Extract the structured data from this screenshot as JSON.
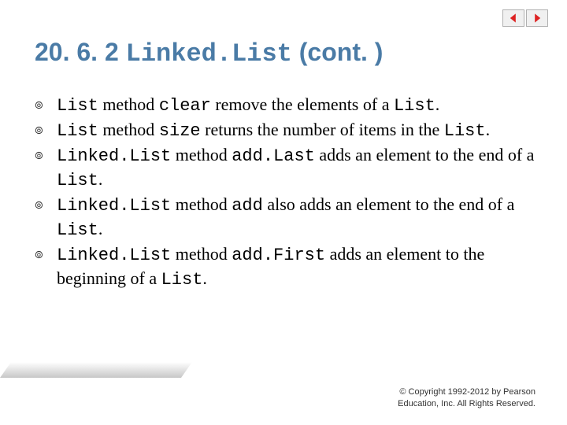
{
  "title": {
    "section": "20. 6. 2 ",
    "code": "Linked.List",
    "rest": " (cont. )"
  },
  "bullets": [
    [
      {
        "t": "List",
        "m": 1
      },
      {
        "t": " method ",
        "m": 0
      },
      {
        "t": "clear",
        "m": 1
      },
      {
        "t": " remove the elements of a ",
        "m": 0
      },
      {
        "t": "List",
        "m": 1
      },
      {
        "t": ".",
        "m": 0
      }
    ],
    [
      {
        "t": "List",
        "m": 1
      },
      {
        "t": " method ",
        "m": 0
      },
      {
        "t": "size",
        "m": 1
      },
      {
        "t": " returns the number of items in the ",
        "m": 0
      },
      {
        "t": "List",
        "m": 1
      },
      {
        "t": ".",
        "m": 0
      }
    ],
    [
      {
        "t": "Linked.List",
        "m": 1
      },
      {
        "t": " method ",
        "m": 0
      },
      {
        "t": "add.Last",
        "m": 1
      },
      {
        "t": " adds an element to the end of a ",
        "m": 0
      },
      {
        "t": "List",
        "m": 1
      },
      {
        "t": ".",
        "m": 0
      }
    ],
    [
      {
        "t": "Linked.List",
        "m": 1
      },
      {
        "t": " method ",
        "m": 0
      },
      {
        "t": "add",
        "m": 1
      },
      {
        "t": " also adds an element to the end of a ",
        "m": 0
      },
      {
        "t": "List",
        "m": 1
      },
      {
        "t": ".",
        "m": 0
      }
    ],
    [
      {
        "t": "Linked.List",
        "m": 1
      },
      {
        "t": " method ",
        "m": 0
      },
      {
        "t": "add.First",
        "m": 1
      },
      {
        "t": " adds an element to the beginning of a ",
        "m": 0
      },
      {
        "t": "List",
        "m": 1
      },
      {
        "t": ".",
        "m": 0
      }
    ]
  ],
  "copyright": {
    "l1": "© Copyright 1992-2012 by Pearson",
    "l2": "Education, Inc. All Rights Reserved."
  }
}
